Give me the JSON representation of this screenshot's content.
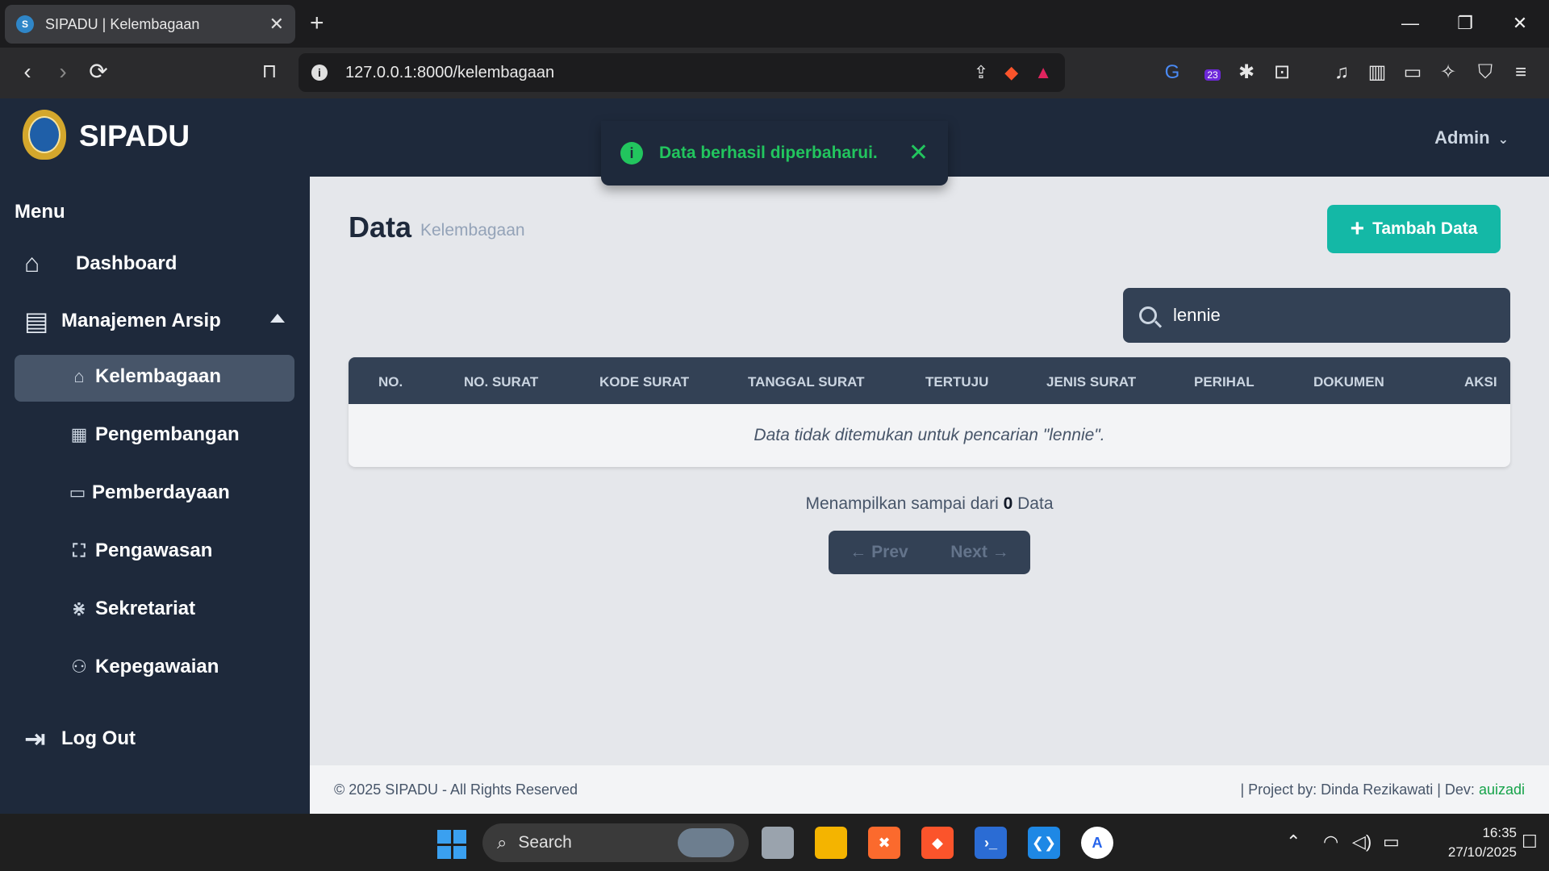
{
  "browser": {
    "tab_title": "SIPADU | Kelembagaan",
    "url": "127.0.0.1:8000/kelembagaan",
    "extension_badge": "23"
  },
  "header": {
    "brand": "SIPADU",
    "user": "Admin"
  },
  "toast": {
    "message": "Data berhasil diperbaharui."
  },
  "sidebar": {
    "menu_title": "Menu",
    "items": [
      {
        "label": "Dashboard",
        "icon": "home-icon"
      },
      {
        "label": "Manajemen Arsip",
        "icon": "archive-icon"
      },
      {
        "label": "Kelembagaan",
        "icon": "building-icon",
        "active": true
      },
      {
        "label": "Pengembangan",
        "icon": "chalkboard-icon"
      },
      {
        "label": "Pemberdayaan",
        "icon": "inbox-icon"
      },
      {
        "label": "Pengawasan",
        "icon": "users-viewfinder-icon"
      },
      {
        "label": "Sekretariat",
        "icon": "people-arrows-icon"
      },
      {
        "label": "Kepegawaian",
        "icon": "users-icon"
      },
      {
        "label": "Log Out",
        "icon": "logout-icon"
      }
    ]
  },
  "main": {
    "title": "Data",
    "subtitle": "Kelembagaan",
    "add_button": "Tambah Data",
    "search_value": "lennie",
    "columns": [
      "NO.",
      "NO. SURAT",
      "KODE SURAT",
      "TANGGAL SURAT",
      "TERTUJU",
      "JENIS SURAT",
      "PERIHAL",
      "DOKUMEN",
      "AKSI"
    ],
    "empty_message": "Data tidak ditemukan untuk pencarian \"lennie\".",
    "showing_prefix": "Menampilkan sampai dari",
    "showing_count": "0",
    "showing_suffix": "Data",
    "prev_label": "Prev",
    "next_label": "Next"
  },
  "footer": {
    "copyright": "© 2025 SIPADU - All Rights Reserved",
    "project": "| Project by: Dinda Rezikawati | Dev:",
    "dev": "auizadi"
  },
  "taskbar": {
    "search_label": "Search",
    "time": "16:35",
    "date": "27/10/2025"
  },
  "colors": {
    "sidebar_bg": "#1e293b",
    "accent_teal": "#14b8a6",
    "toast_green": "#22c55e"
  }
}
